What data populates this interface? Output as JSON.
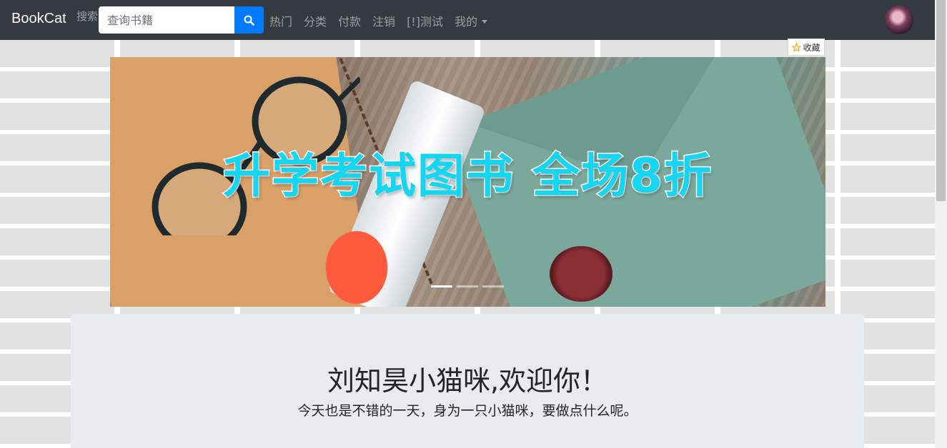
{
  "navbar": {
    "brand": "BookCat",
    "search_label": "搜索",
    "search_placeholder": "查询书籍",
    "links": [
      "热门",
      "分类",
      "付款",
      "注销",
      "[!]测试",
      "我的"
    ]
  },
  "favorite": {
    "label": "收藏"
  },
  "carousel": {
    "banner_text": "升学考试图书 全场8折",
    "indicator_count": 3,
    "active_index": 0
  },
  "jumbotron": {
    "title": "刘知昊小猫咪,欢迎你！",
    "subtitle": "今天也是不错的一天，身为一只小猫咪，要做点什么呢。"
  },
  "colors": {
    "navbar_bg": "#343a40",
    "accent": "#007bff",
    "banner_text": "#14d6f0",
    "jumbotron_bg": "#e9ecef"
  },
  "icons": [
    "search-icon",
    "star-icon",
    "chevron-left-icon",
    "chevron-right-icon",
    "caret-down-icon"
  ]
}
